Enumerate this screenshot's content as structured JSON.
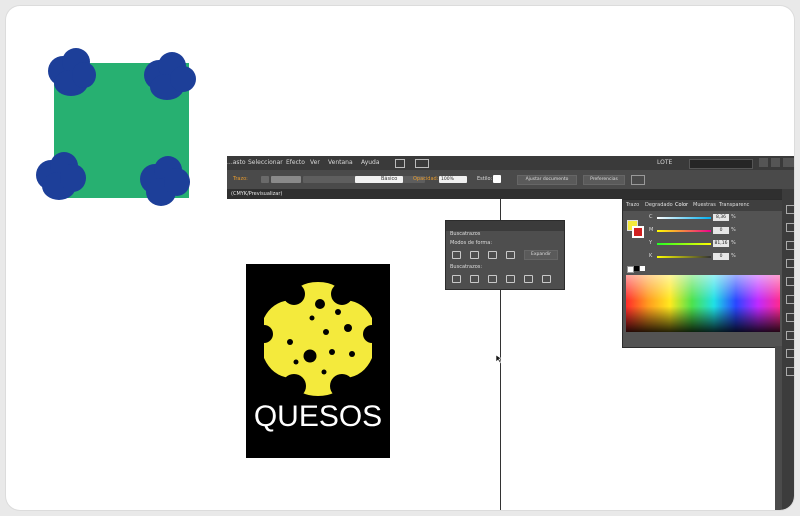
{
  "colors": {
    "green": "#27b071",
    "blue_blobs": "#1d3f99",
    "cheese": "#f4ea3c",
    "logo_bg": "#000000"
  },
  "illustrator": {
    "menu": [
      "...asto",
      "Seleccionar",
      "Efecto",
      "Ver",
      "Ventana",
      "Ayuda"
    ],
    "workspace_label": "LOTE",
    "control": {
      "trazo_label": "Trazo:",
      "brush_label": "Básico",
      "opacidad_label": "Opacidad:",
      "opacidad_value": "100%",
      "estilo_label": "Estilo:",
      "ajustar_button": "Ajustar documento",
      "preferencias_button": "Preferencias"
    },
    "doc_tab": "(CMYK/Previsualizar)",
    "buscatrazos": {
      "title": "Buscatrazos",
      "modos": "Modos de forma:",
      "expandir": "Expandir",
      "buscatrazos": "Buscatrazos:"
    },
    "color_panel": {
      "tabs": [
        "Trazo",
        "Degradado",
        "Color",
        "Muestras",
        "Transparenc"
      ],
      "channels": [
        {
          "name": "C",
          "value": "8,36"
        },
        {
          "name": "M",
          "value": "0"
        },
        {
          "name": "Y",
          "value": "81,16"
        },
        {
          "name": "K",
          "value": "0"
        }
      ],
      "pct": "%"
    }
  },
  "logo_text": "QUESOS"
}
